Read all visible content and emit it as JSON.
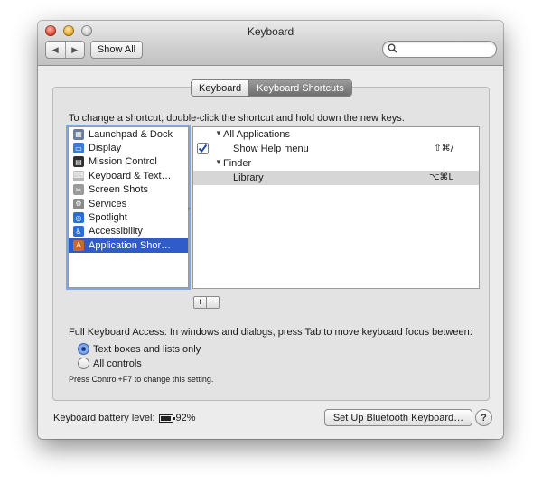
{
  "window": {
    "title": "Keyboard"
  },
  "toolbar": {
    "back_glyph": "◀",
    "forward_glyph": "▶",
    "show_all_label": "Show All",
    "search_placeholder": "",
    "search_icon": "magnifier-icon"
  },
  "tabs": [
    {
      "label": "Keyboard",
      "active": false
    },
    {
      "label": "Keyboard Shortcuts",
      "active": true
    }
  ],
  "instruction": "To change a shortcut, double-click the shortcut and hold down the new keys.",
  "categories": [
    {
      "label": "Launchpad & Dock",
      "icon": "launchpad-icon",
      "icon_color": "#6a7d99"
    },
    {
      "label": "Display",
      "icon": "display-icon",
      "icon_color": "#3f7ad1"
    },
    {
      "label": "Mission Control",
      "icon": "mission-control-icon",
      "icon_color": "#2f2f2f"
    },
    {
      "label": "Keyboard & Text…",
      "icon": "keyboard-icon",
      "icon_color": "#b8b8b8"
    },
    {
      "label": "Screen Shots",
      "icon": "screenshot-icon",
      "icon_color": "#9a9a9a"
    },
    {
      "label": "Services",
      "icon": "gear-icon",
      "icon_color": "#8b8b8b"
    },
    {
      "label": "Spotlight",
      "icon": "spotlight-icon",
      "icon_color": "#2b6fd6"
    },
    {
      "label": "Accessibility",
      "icon": "accessibility-icon",
      "icon_color": "#2b6fd6"
    },
    {
      "label": "Application Shor…",
      "icon": "app-shortcuts-icon",
      "icon_color": "#c86a2f",
      "selected": true
    }
  ],
  "shortcuts": [
    {
      "type": "group",
      "label": "All Applications",
      "expanded": true
    },
    {
      "type": "item",
      "label": "Show Help menu",
      "checked": true,
      "keys": "⇧⌘/"
    },
    {
      "type": "group",
      "label": "Finder",
      "expanded": true
    },
    {
      "type": "item",
      "label": "Library",
      "checked": false,
      "keys": "⌥⌘L",
      "highlighted": true
    }
  ],
  "list_controls": {
    "add": "+",
    "remove": "−"
  },
  "full_keyboard_access": {
    "label": "Full Keyboard Access: In windows and dialogs, press Tab to move keyboard focus between:",
    "options": [
      {
        "label": "Text boxes and lists only",
        "selected": true
      },
      {
        "label": "All controls",
        "selected": false
      }
    ],
    "hint": "Press Control+F7 to change this setting."
  },
  "footer": {
    "battery_label": "Keyboard battery level:",
    "battery_value": "92%",
    "setup_button": "Set Up Bluetooth Keyboard…",
    "help_glyph": "?"
  }
}
